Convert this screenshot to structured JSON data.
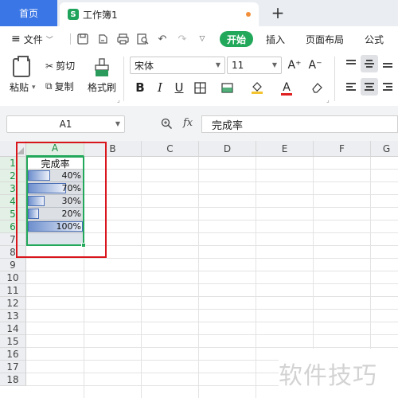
{
  "tabs": {
    "home_label": "首页",
    "doc_icon_letter": "S",
    "doc_title": "工作簿1",
    "new_tab_label": "+"
  },
  "menu": {
    "file_label": "文件",
    "items": [
      "开始",
      "插入",
      "页面布局",
      "公式"
    ]
  },
  "ribbon": {
    "paste_label": "粘贴",
    "cut_label": "剪切",
    "copy_label": "复制",
    "format_painter_label": "格式刷",
    "font_name": "宋体",
    "font_size": "11",
    "grow_font": "A⁺",
    "shrink_font": "A⁻",
    "bold": "B",
    "italic": "I",
    "underline": "U",
    "font_color_letter": "A"
  },
  "formula_bar": {
    "name_box": "A1",
    "fx_label": "fx",
    "content": "完成率"
  },
  "grid": {
    "columns": [
      "A",
      "B",
      "C",
      "D",
      "E",
      "F",
      "G"
    ],
    "rows": [
      "1",
      "2",
      "3",
      "4",
      "5",
      "6",
      "7",
      "8",
      "9",
      "10",
      "11",
      "12",
      "13",
      "14",
      "15",
      "16",
      "17",
      "18"
    ],
    "column_A": {
      "header": "完成率",
      "values": [
        "40%",
        "70%",
        "30%",
        "20%",
        "100%"
      ],
      "fractions": [
        0.4,
        0.7,
        0.3,
        0.2,
        1.0
      ]
    }
  },
  "colors": {
    "accent_green": "#22a85a",
    "tab_blue": "#3a76e6",
    "annotation_red": "#d9161c",
    "databar_blue": "#4a6fb5"
  },
  "watermark": "软件技巧"
}
